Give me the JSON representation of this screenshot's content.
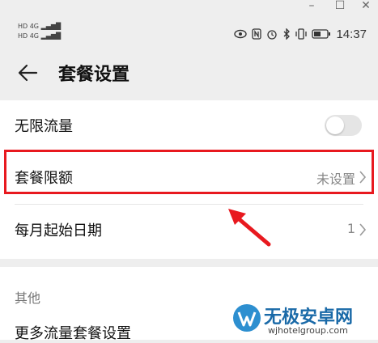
{
  "window": {
    "minimize": "–",
    "maximize": "☐",
    "close": "✕"
  },
  "statusbar": {
    "sim1": "HD 4G",
    "sim2": "HD 4G",
    "time": "14:37",
    "icons": [
      "eye-icon",
      "nfc-icon",
      "alarm-icon",
      "bluetooth-icon",
      "vibrate-icon",
      "battery-icon"
    ]
  },
  "header": {
    "title": "套餐设置",
    "back_icon": "back-arrow-icon"
  },
  "settings": {
    "unlimited_label": "无限流量",
    "unlimited_on": false,
    "limit_label": "套餐限额",
    "limit_value": "未设置",
    "start_date_label": "每月起始日期",
    "start_date_value": "1"
  },
  "other": {
    "section_title": "其他",
    "more_plans_label": "更多流量套餐设置"
  },
  "watermark": {
    "name": "无极安卓网",
    "url": "wjhotelgroup.com"
  },
  "colors": {
    "highlight": "#e8191f",
    "arrow": "#e8191f"
  }
}
